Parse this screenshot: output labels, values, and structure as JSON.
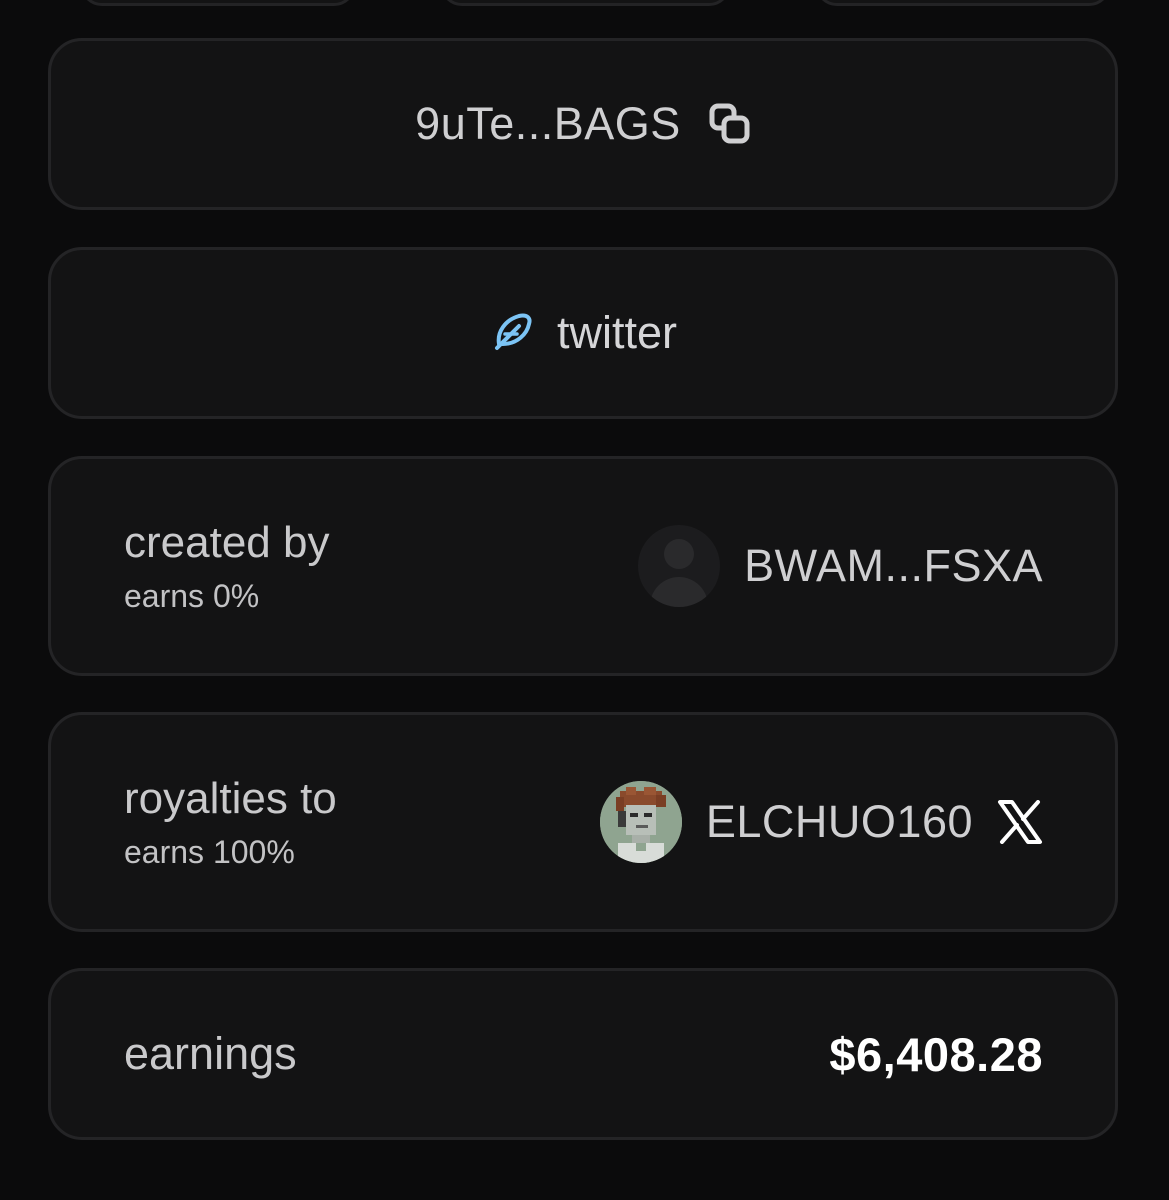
{
  "contract": {
    "address_short": "9uTe...BAGS",
    "copy_icon": "copy-icon"
  },
  "social": {
    "label": "twitter",
    "icon": "feather-icon",
    "icon_color": "#7cc4f5"
  },
  "creator": {
    "label": "created by",
    "earns": "earns 0%",
    "handle": "BWAM...FSXA",
    "avatar": "default-avatar"
  },
  "royalties": {
    "label": "royalties to",
    "earns": "earns 100%",
    "handle": "ELCHUO160",
    "avatar": "pixel-art-avatar",
    "social_icon": "x-icon"
  },
  "earnings": {
    "label": "earnings",
    "value": "$6,408.28"
  }
}
